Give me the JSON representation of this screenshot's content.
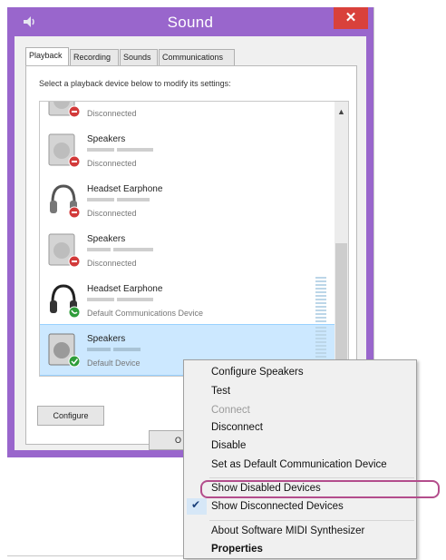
{
  "window": {
    "title": "Sound",
    "close_symbol": "✕"
  },
  "tabs": [
    {
      "label": "Playback",
      "active": true
    },
    {
      "label": "Recording"
    },
    {
      "label": "Sounds"
    },
    {
      "label": "Communications"
    }
  ],
  "instruction": "Select a playback device below to modify its settings:",
  "devices": [
    {
      "name": "",
      "status": "Disconnected",
      "icon": "speaker-icon",
      "badge": "red-disconnected"
    },
    {
      "name": "Speakers",
      "status": "Disconnected",
      "icon": "speaker-icon",
      "badge": "red-disconnected"
    },
    {
      "name": "Headset Earphone",
      "status": "Disconnected",
      "icon": "headset-icon",
      "badge": "red-disconnected"
    },
    {
      "name": "Speakers",
      "status": "Disconnected",
      "icon": "speaker-icon",
      "badge": "red-disconnected"
    },
    {
      "name": "Headset Earphone",
      "status": "Default Communications Device",
      "icon": "headset-icon",
      "badge": "green-phone"
    },
    {
      "name": "Speakers",
      "status": "Default Device",
      "icon": "speaker-icon",
      "badge": "green-check",
      "selected": true
    }
  ],
  "buttons": {
    "configure": "Configure",
    "ok": "O"
  },
  "context_menu": {
    "items": [
      {
        "label": "Configure Speakers"
      },
      {
        "label": "Test"
      },
      {
        "label": "Connect",
        "disabled": true
      },
      {
        "label": "Disconnect"
      },
      {
        "label": "Disable"
      },
      {
        "label": "Set as Default Communication Device"
      },
      {
        "label": "Show Disabled Devices",
        "highlighted": true
      },
      {
        "label": "Show Disconnected Devices",
        "checked": true
      },
      {
        "label": "About Software MIDI Synthesizer"
      },
      {
        "label": "Properties",
        "bold": true
      }
    ],
    "check_symbol": "✔"
  },
  "colors": {
    "window_frame": "#9966cc",
    "close_button": "#d9413b",
    "selection": "#cce8ff",
    "highlight_outline": "#b34d8c",
    "disconnected_badge": "#d23a3a",
    "default_badge": "#2e9d3a"
  }
}
